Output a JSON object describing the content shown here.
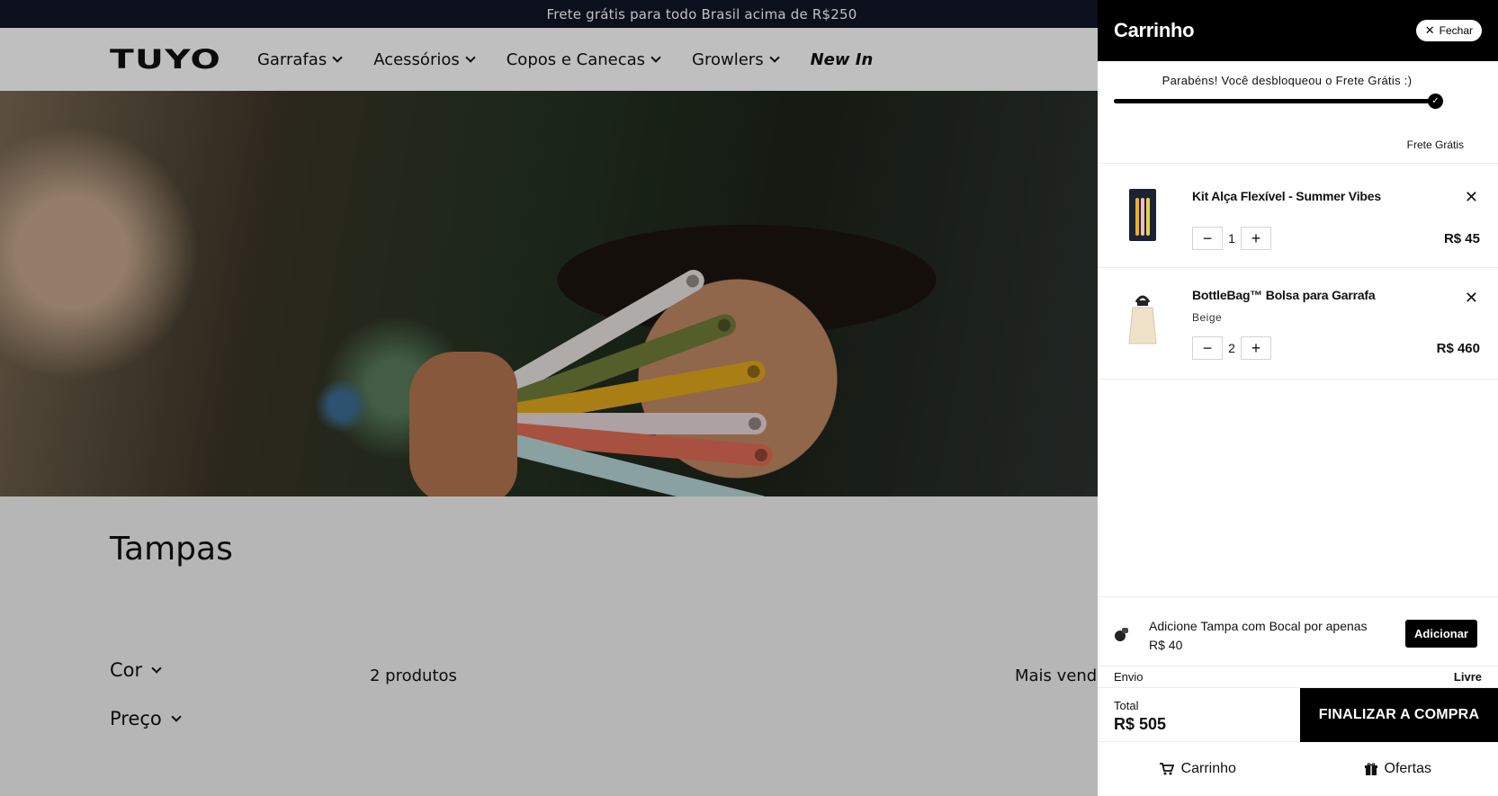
{
  "announcement": "Frete grátis para todo Brasil acima de R$250",
  "header": {
    "logo": "TUYO",
    "nav": [
      {
        "label": "Garrafas"
      },
      {
        "label": "Acessórios"
      },
      {
        "label": "Copos e Canecas"
      },
      {
        "label": "Growlers"
      },
      {
        "label": "New In"
      }
    ]
  },
  "collection": {
    "title": "Tampas",
    "filters": [
      "Cor",
      "Preço"
    ],
    "count": "2 produtos",
    "sort": "Mais vend"
  },
  "cart": {
    "title": "Carrinho",
    "close_label": "Fechar",
    "free_shipping_msg": "Parabéns! Você desbloqueou o Frete Grátis :)",
    "progress_fraction": 1.0,
    "progress_label": "Frete Grátis",
    "items": [
      {
        "name": "Kit Alça Flexível - Summer Vibes",
        "variant": "",
        "qty": "1",
        "price": "R$ 45",
        "thumb_icon": "handle-kit-thumb"
      },
      {
        "name": "BottleBag™ Bolsa para Garrafa",
        "variant": "Beige",
        "qty": "2",
        "price": "R$ 460",
        "thumb_icon": "bottlebag-thumb"
      }
    ],
    "upsell": {
      "text_line1": "Adicione Tampa com Bocal por apenas",
      "text_line2": "R$ 40",
      "button": "Adicionar"
    },
    "shipping": {
      "label": "Envio",
      "value": "Livre"
    },
    "total": {
      "label": "Total",
      "value": "R$ 505"
    },
    "checkout_label": "FINALIZAR A COMPRA",
    "tabs": [
      {
        "label": "Carrinho",
        "icon": "cart-icon"
      },
      {
        "label": "Ofertas",
        "icon": "gift-icon"
      }
    ]
  }
}
